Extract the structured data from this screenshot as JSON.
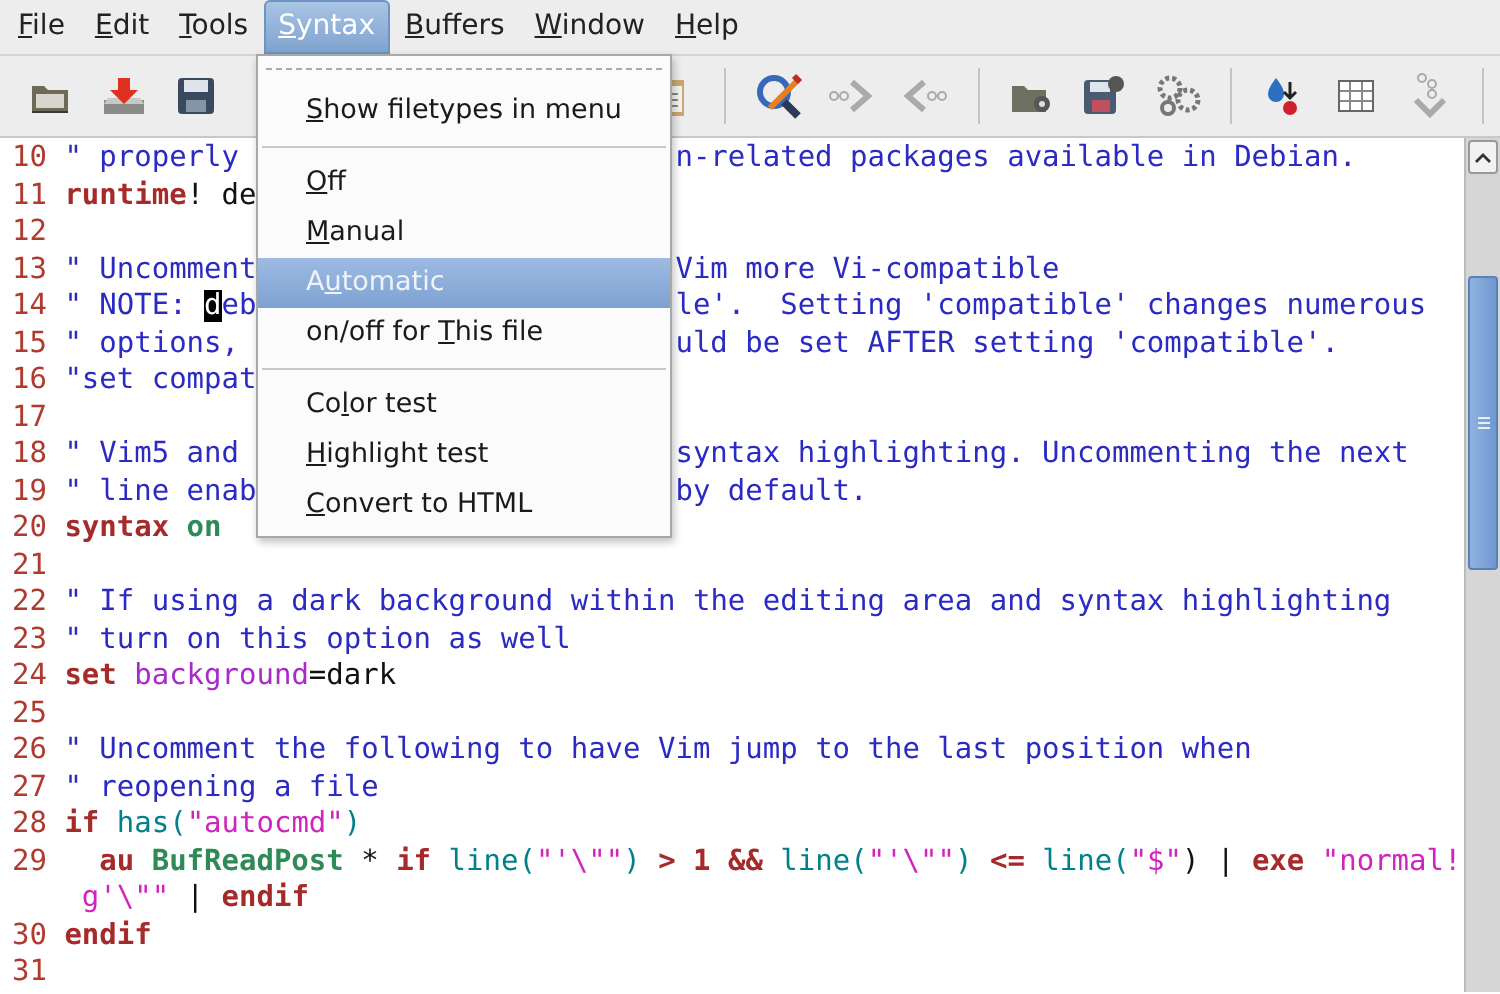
{
  "menubar": [
    {
      "accel": "F",
      "after": "ile",
      "selected": false
    },
    {
      "accel": "E",
      "after": "dit",
      "selected": false
    },
    {
      "accel": "T",
      "after": "ools",
      "selected": false
    },
    {
      "accel": "S",
      "after": "yntax",
      "selected": true
    },
    {
      "accel": "B",
      "after": "uffers",
      "selected": false
    },
    {
      "accel": "W",
      "after": "indow",
      "selected": false
    },
    {
      "accel": "H",
      "after": "elp",
      "selected": false
    }
  ],
  "syntax_menu": [
    {
      "kind": "tearoff"
    },
    {
      "kind": "item",
      "accel": "S",
      "after": "how filetypes in menu",
      "selected": false
    },
    {
      "kind": "separator"
    },
    {
      "kind": "item",
      "accel": "O",
      "after": "ff",
      "selected": false
    },
    {
      "kind": "item",
      "accel": "M",
      "after": "anual",
      "selected": false
    },
    {
      "kind": "item",
      "before": "A",
      "accel": "u",
      "after": "tomatic",
      "selected": true
    },
    {
      "kind": "item",
      "before": "on/off for ",
      "accel": "T",
      "after": "his file",
      "selected": false
    },
    {
      "kind": "separator"
    },
    {
      "kind": "item",
      "before": "Co",
      "accel": "l",
      "after": "or test",
      "selected": false
    },
    {
      "kind": "item",
      "accel": "H",
      "after": "ighlight test",
      "selected": false
    },
    {
      "kind": "item",
      "accel": "C",
      "after": "onvert to HTML",
      "selected": false
    }
  ],
  "lines": [
    {
      "number": "10",
      "segments": [
        {
          "text": "\" properly",
          "kind": "comment"
        }
      ],
      "after_menu": [
        {
          "text": "n-related packages available in Debian.",
          "kind": "comment"
        }
      ]
    },
    {
      "number": "11",
      "segments": [
        {
          "text": "runtime",
          "kind": "statement"
        },
        {
          "text": "! de",
          "kind": "plain"
        }
      ]
    },
    {
      "number": "12"
    },
    {
      "number": "13",
      "segments": [
        {
          "text": "\" Uncomment",
          "kind": "comment"
        }
      ],
      "after_menu": [
        {
          "text": "Vim more Vi-compatible",
          "kind": "comment"
        }
      ]
    },
    {
      "number": "14",
      "segments": [
        {
          "text": "\" NOTE: ",
          "kind": "comment"
        },
        {
          "text": "d",
          "kind": "cursor"
        },
        {
          "text": "eb",
          "kind": "comment"
        }
      ],
      "after_menu": [
        {
          "text": "le'.  Setting 'compatible' changes numerous",
          "kind": "comment"
        }
      ]
    },
    {
      "number": "15",
      "segments": [
        {
          "text": "\" options,",
          "kind": "comment"
        }
      ],
      "after_menu": [
        {
          "text": "uld be set AFTER setting 'compatible'.",
          "kind": "comment"
        }
      ]
    },
    {
      "number": "16",
      "segments": [
        {
          "text": "\"set compat",
          "kind": "comment"
        }
      ]
    },
    {
      "number": "17"
    },
    {
      "number": "18",
      "segments": [
        {
          "text": "\" Vim5 and",
          "kind": "comment"
        }
      ],
      "after_menu": [
        {
          "text": "syntax highlighting. Uncommenting the next",
          "kind": "comment"
        }
      ]
    },
    {
      "number": "19",
      "segments": [
        {
          "text": "\" line enab",
          "kind": "comment"
        }
      ],
      "after_menu": [
        {
          "text": "by default.",
          "kind": "comment"
        }
      ]
    },
    {
      "number": "20",
      "segments": [
        {
          "text": "syntax",
          "kind": "statement"
        },
        {
          "text": " on",
          "kind": "type"
        }
      ]
    },
    {
      "number": "21"
    },
    {
      "number": "22",
      "segments": [
        {
          "text": "\" If using a dark background within the editing area and syntax highlighting",
          "kind": "comment"
        }
      ]
    },
    {
      "number": "23",
      "segments": [
        {
          "text": "\" turn on this option as well",
          "kind": "comment"
        }
      ]
    },
    {
      "number": "24",
      "segments": [
        {
          "text": "set",
          "kind": "statement"
        },
        {
          "text": " background",
          "kind": "option"
        },
        {
          "text": "=dark",
          "kind": "plain"
        }
      ]
    },
    {
      "number": "25"
    },
    {
      "number": "26",
      "segments": [
        {
          "text": "\" Uncomment the following to have Vim jump to the last position when",
          "kind": "comment"
        }
      ]
    },
    {
      "number": "27",
      "segments": [
        {
          "text": "\" reopening a file",
          "kind": "comment"
        }
      ]
    },
    {
      "number": "28",
      "segments": [
        {
          "text": "if",
          "kind": "statement"
        },
        {
          "text": " has(",
          "kind": "function"
        },
        {
          "text": "\"autocmd\"",
          "kind": "string"
        },
        {
          "text": ")",
          "kind": "function"
        }
      ]
    },
    {
      "number": "29",
      "segments": [
        {
          "text": "  au",
          "kind": "statement"
        },
        {
          "text": " BufReadPost",
          "kind": "type"
        },
        {
          "text": " * ",
          "kind": "plain"
        },
        {
          "text": "if",
          "kind": "statement"
        },
        {
          "text": " line(",
          "kind": "function"
        },
        {
          "text": "\"'\\\"\"",
          "kind": "string"
        },
        {
          "text": ") ",
          "kind": "function"
        },
        {
          "text": "> 1 &&",
          "kind": "statement"
        },
        {
          "text": " line(",
          "kind": "function"
        },
        {
          "text": "\"'\\\"\"",
          "kind": "string"
        },
        {
          "text": ") ",
          "kind": "function"
        },
        {
          "text": "<=",
          "kind": "statement"
        },
        {
          "text": " line(",
          "kind": "function"
        },
        {
          "text": "\"$\"",
          "kind": "string"
        },
        {
          "text": ") | ",
          "kind": "plain"
        },
        {
          "text": "exe",
          "kind": "statement"
        },
        {
          "text": " \"normal!",
          "kind": "string"
        }
      ]
    },
    {
      "segments": [
        {
          "text": " g'\\\"\"",
          "kind": "string"
        },
        {
          "text": " | ",
          "kind": "plain"
        },
        {
          "text": "endif",
          "kind": "statement"
        }
      ]
    },
    {
      "number": "30",
      "segments": [
        {
          "text": "endif",
          "kind": "statement"
        }
      ]
    },
    {
      "number": "31"
    }
  ]
}
